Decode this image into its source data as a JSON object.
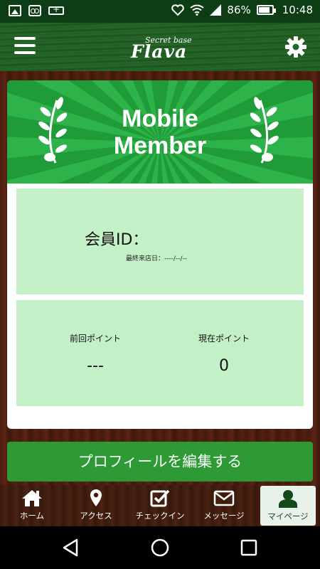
{
  "status_bar": {
    "battery_percent": "86%",
    "time": "10:48"
  },
  "header": {
    "logo_small": "Secret base",
    "logo_big": "Flava"
  },
  "card": {
    "title_line1": "Mobile",
    "title_line2": "Member",
    "member_id_label": "会員ID：",
    "last_visit": "最終来店日：----/--/--",
    "previous_points_label": "前回ポイント",
    "previous_points_value": "---",
    "current_points_label": "現在ポイント",
    "current_points_value": "0"
  },
  "edit_profile_label": "プロフィールを編集する",
  "tabs": [
    {
      "label": "ホーム",
      "icon": "home-icon"
    },
    {
      "label": "アクセス",
      "icon": "map-pin-icon"
    },
    {
      "label": "チェックイン",
      "icon": "checkbox-icon"
    },
    {
      "label": "メッセージ",
      "icon": "envelope-icon"
    },
    {
      "label": "マイページ",
      "icon": "user-icon"
    }
  ],
  "colors": {
    "header_green": "#27692a",
    "card_green": "#2eb24a",
    "panel_green": "#c4f0c8",
    "button_green": "#2e9a35",
    "active_tab_bg": "#e8f1ea"
  }
}
